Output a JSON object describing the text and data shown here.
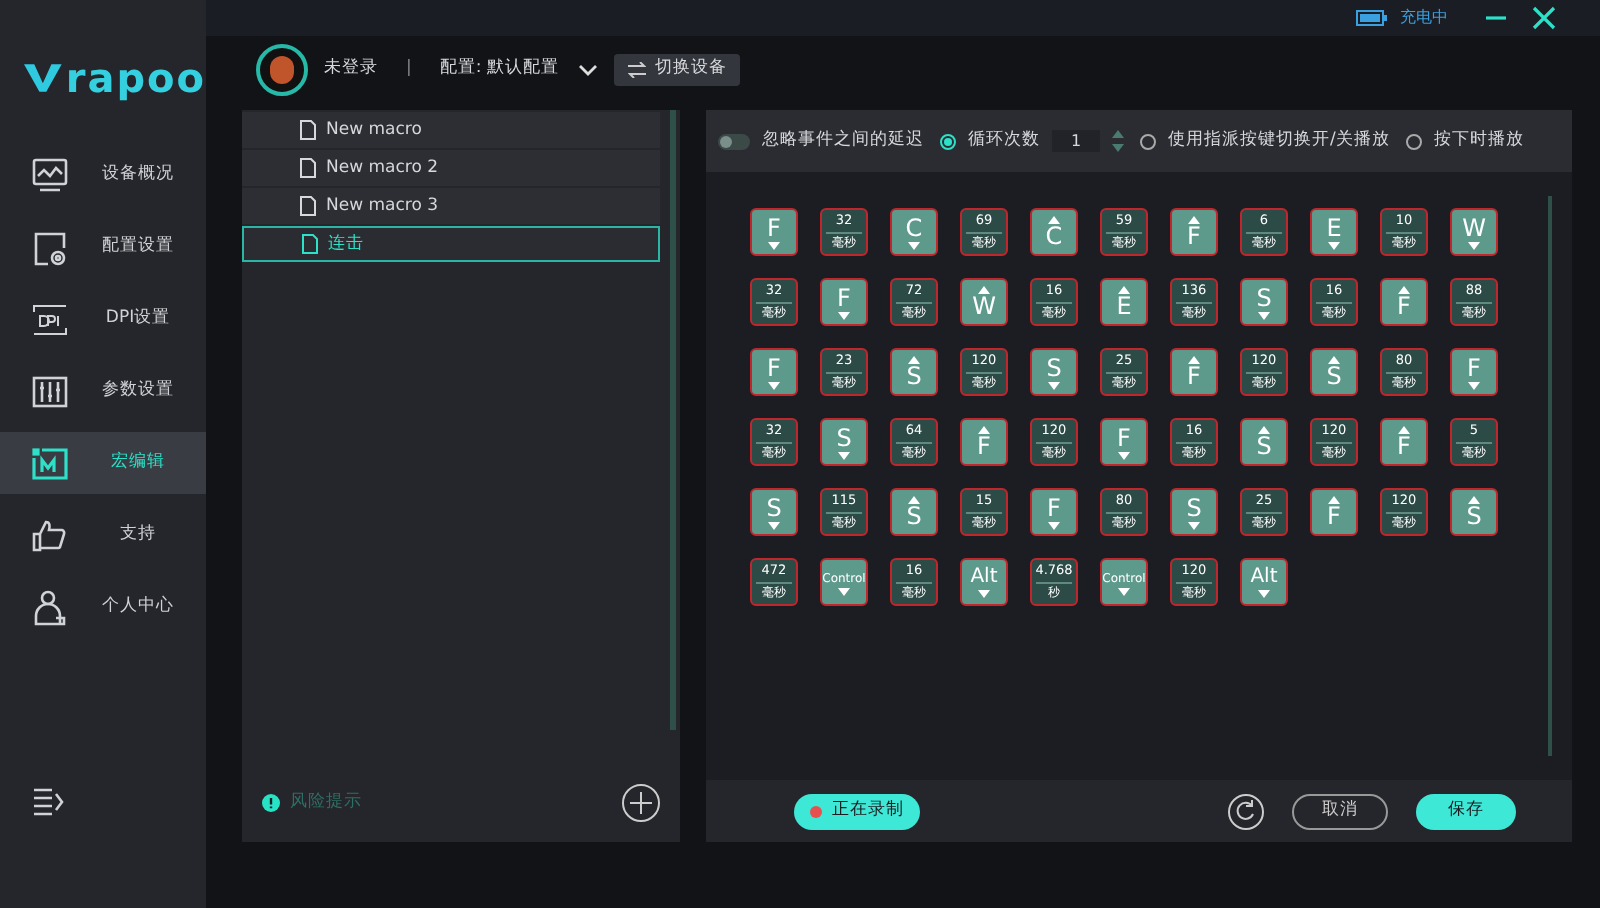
{
  "title_bar": {
    "battery_status": "充电中"
  },
  "brand": {
    "logo_text": "rapoo"
  },
  "sidebar": {
    "items": [
      {
        "label": "设备概况",
        "selected": false
      },
      {
        "label": "配置设置",
        "selected": false
      },
      {
        "label": "DPI设置",
        "selected": false
      },
      {
        "label": "参数设置",
        "selected": false
      },
      {
        "label": "宏编辑",
        "selected": true
      },
      {
        "label": "支持",
        "selected": false
      },
      {
        "label": "个人中心",
        "selected": false
      }
    ]
  },
  "header": {
    "user": "未登录",
    "separator": "|",
    "profile": "配置: 默认配置",
    "switch_button": "切换设备"
  },
  "macro_list": {
    "items": [
      {
        "name": "New macro",
        "selected": false
      },
      {
        "name": "New macro 2",
        "selected": false
      },
      {
        "name": "New macro 3",
        "selected": false
      },
      {
        "name": "连击",
        "selected": true
      }
    ],
    "risk_hint": "风险提示"
  },
  "options": {
    "ignore_delay": {
      "label": "忽略事件之间的延迟",
      "on": false
    },
    "modes": [
      {
        "label": "循环次数",
        "selected": true
      },
      {
        "label": "使用指派按键切换开/关播放",
        "selected": false
      },
      {
        "label": "按下时播放",
        "selected": false
      }
    ],
    "loop_count": "1"
  },
  "events": [
    {
      "kind": "key_down",
      "label": "F"
    },
    {
      "kind": "delay",
      "value": "32",
      "unit": "毫秒"
    },
    {
      "kind": "key_down",
      "label": "C"
    },
    {
      "kind": "delay",
      "value": "69",
      "unit": "毫秒"
    },
    {
      "kind": "key_up",
      "label": "C"
    },
    {
      "kind": "delay",
      "value": "59",
      "unit": "毫秒"
    },
    {
      "kind": "key_up",
      "label": "F"
    },
    {
      "kind": "delay",
      "value": "6",
      "unit": "毫秒"
    },
    {
      "kind": "key_down",
      "label": "E"
    },
    {
      "kind": "delay",
      "value": "10",
      "unit": "毫秒"
    },
    {
      "kind": "key_down",
      "label": "W"
    },
    {
      "kind": "delay",
      "value": "32",
      "unit": "毫秒"
    },
    {
      "kind": "key_down",
      "label": "F"
    },
    {
      "kind": "delay",
      "value": "72",
      "unit": "毫秒"
    },
    {
      "kind": "key_up",
      "label": "W"
    },
    {
      "kind": "delay",
      "value": "16",
      "unit": "毫秒"
    },
    {
      "kind": "key_up",
      "label": "E"
    },
    {
      "kind": "delay",
      "value": "136",
      "unit": "毫秒"
    },
    {
      "kind": "key_down",
      "label": "S"
    },
    {
      "kind": "delay",
      "value": "16",
      "unit": "毫秒"
    },
    {
      "kind": "key_up",
      "label": "F"
    },
    {
      "kind": "delay",
      "value": "88",
      "unit": "毫秒"
    },
    {
      "kind": "key_down",
      "label": "F"
    },
    {
      "kind": "delay",
      "value": "23",
      "unit": "毫秒"
    },
    {
      "kind": "key_up",
      "label": "S"
    },
    {
      "kind": "delay",
      "value": "120",
      "unit": "毫秒"
    },
    {
      "kind": "key_down",
      "label": "S"
    },
    {
      "kind": "delay",
      "value": "25",
      "unit": "毫秒"
    },
    {
      "kind": "key_up",
      "label": "F"
    },
    {
      "kind": "delay",
      "value": "120",
      "unit": "毫秒"
    },
    {
      "kind": "key_up",
      "label": "S"
    },
    {
      "kind": "delay",
      "value": "80",
      "unit": "毫秒"
    },
    {
      "kind": "key_down",
      "label": "F"
    },
    {
      "kind": "delay",
      "value": "32",
      "unit": "毫秒"
    },
    {
      "kind": "key_down",
      "label": "S"
    },
    {
      "kind": "delay",
      "value": "64",
      "unit": "毫秒"
    },
    {
      "kind": "key_up",
      "label": "F"
    },
    {
      "kind": "delay",
      "value": "120",
      "unit": "毫秒"
    },
    {
      "kind": "key_down",
      "label": "F"
    },
    {
      "kind": "delay",
      "value": "16",
      "unit": "毫秒"
    },
    {
      "kind": "key_up",
      "label": "S"
    },
    {
      "kind": "delay",
      "value": "120",
      "unit": "毫秒"
    },
    {
      "kind": "key_up",
      "label": "F"
    },
    {
      "kind": "delay",
      "value": "5",
      "unit": "毫秒"
    },
    {
      "kind": "key_down",
      "label": "S"
    },
    {
      "kind": "delay",
      "value": "115",
      "unit": "毫秒"
    },
    {
      "kind": "key_up",
      "label": "S"
    },
    {
      "kind": "delay",
      "value": "15",
      "unit": "毫秒"
    },
    {
      "kind": "key_down",
      "label": "F"
    },
    {
      "kind": "delay",
      "value": "80",
      "unit": "毫秒"
    },
    {
      "kind": "key_down",
      "label": "S"
    },
    {
      "kind": "delay",
      "value": "25",
      "unit": "毫秒"
    },
    {
      "kind": "key_up",
      "label": "F"
    },
    {
      "kind": "delay",
      "value": "120",
      "unit": "毫秒"
    },
    {
      "kind": "key_up",
      "label": "S"
    },
    {
      "kind": "delay",
      "value": "472",
      "unit": "毫秒"
    },
    {
      "kind": "key_down",
      "label": "Control"
    },
    {
      "kind": "delay",
      "value": "16",
      "unit": "毫秒"
    },
    {
      "kind": "key_down",
      "label": "Alt"
    },
    {
      "kind": "delay",
      "value": "4.768",
      "unit": "秒"
    },
    {
      "kind": "key_down",
      "label": "Control"
    },
    {
      "kind": "delay",
      "value": "120",
      "unit": "毫秒"
    },
    {
      "kind": "key_down",
      "label": "Alt"
    }
  ],
  "footer": {
    "record_button": "正在录制",
    "recording": true,
    "cancel_button": "取消",
    "save_button": "保存"
  }
}
